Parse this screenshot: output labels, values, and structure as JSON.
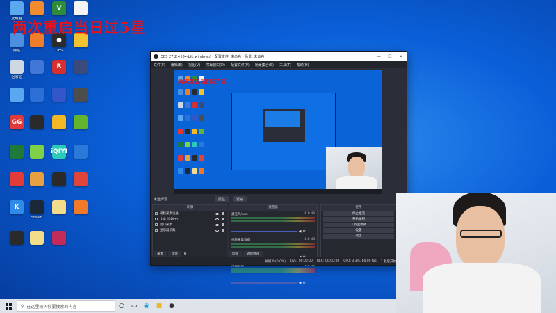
{
  "overlay_title": "两次重启当日过5星",
  "desktop_icons": [
    {
      "label": "此电脑",
      "color": "#5aa8f0",
      "glyph": ""
    },
    {
      "label": "",
      "color": "#f08b30",
      "glyph": ""
    },
    {
      "label": "",
      "color": "#2e8b3a",
      "glyph": "V"
    },
    {
      "label": "",
      "color": "#f4f4f4",
      "glyph": ""
    },
    {
      "label": "网络",
      "color": "#4a8fe0",
      "glyph": ""
    },
    {
      "label": "",
      "color": "#f07d2a",
      "glyph": ""
    },
    {
      "label": "OBS",
      "color": "#2b2b2b",
      "glyph": "●"
    },
    {
      "label": "",
      "color": "#f2c230",
      "glyph": ""
    },
    {
      "label": "回收站",
      "color": "#cfd7e2",
      "glyph": ""
    },
    {
      "label": "",
      "color": "#4178d8",
      "glyph": ""
    },
    {
      "label": "",
      "color": "#d62f2f",
      "glyph": "R"
    },
    {
      "label": "",
      "color": "#3a4a7a",
      "glyph": ""
    },
    {
      "label": "",
      "color": "#5aa8f0",
      "glyph": ""
    },
    {
      "label": "",
      "color": "#2c6fd6",
      "glyph": ""
    },
    {
      "label": "",
      "color": "#3356c8",
      "glyph": ""
    },
    {
      "label": "",
      "color": "#4d4d4d",
      "glyph": ""
    },
    {
      "label": "",
      "color": "#e23a3a",
      "glyph": "GG"
    },
    {
      "label": "",
      "color": "#2a2a2a",
      "glyph": ""
    },
    {
      "label": "",
      "color": "#f2b825",
      "glyph": ""
    },
    {
      "label": "",
      "color": "#63b530",
      "glyph": ""
    },
    {
      "label": "",
      "color": "#1f7a3a",
      "glyph": ""
    },
    {
      "label": "",
      "color": "#7fd247",
      "glyph": ""
    },
    {
      "label": "",
      "color": "#2ccbb8",
      "glyph": "iQIYI"
    },
    {
      "label": "",
      "color": "#2a78d8",
      "glyph": ""
    },
    {
      "label": "",
      "color": "#e33a3a",
      "glyph": ""
    },
    {
      "label": "",
      "color": "#e8a040",
      "glyph": ""
    },
    {
      "label": "",
      "color": "#2a2a2a",
      "glyph": ""
    },
    {
      "label": "",
      "color": "#e0453a",
      "glyph": ""
    },
    {
      "label": "",
      "color": "#2f8be8",
      "glyph": "K"
    },
    {
      "label": "Steam",
      "color": "#1b2838",
      "glyph": ""
    },
    {
      "label": "",
      "color": "#f3dc8a",
      "glyph": ""
    },
    {
      "label": "",
      "color": "#f07a2a",
      "glyph": ""
    },
    {
      "label": "",
      "color": "#2a2a2a",
      "glyph": ""
    },
    {
      "label": "",
      "color": "#f3dc8a",
      "glyph": ""
    },
    {
      "label": "",
      "color": "#c22b5a",
      "glyph": ""
    }
  ],
  "obs": {
    "title": "OBS 27.2.4 (64-bit, windows) - 配置文件: 未命名 - 场景: 未命名",
    "menu": [
      "文件(F)",
      "编辑(E)",
      "视图(V)",
      "停靠窗口(D)",
      "配置文件(P)",
      "场景集合(S)",
      "工具(T)",
      "帮助(H)"
    ],
    "preview_title": "两次重启当日过5星",
    "context_label": "未选择源",
    "context_buttons": [
      "属性",
      "滤镜"
    ],
    "sources_header": "来源",
    "sources": [
      "视频采集设备",
      "文本 (GDI+)",
      "窗口采集",
      "显示器采集"
    ],
    "mixer_header": "混音器",
    "mixer": [
      {
        "name": "麦克风/Aux",
        "db": "0.0 dB"
      },
      {
        "name": "视频采集设备",
        "db": "0.0 dB"
      },
      {
        "name": "桌面音频",
        "db": "0.0 dB"
      }
    ],
    "controls_header": "控件",
    "controls": [
      "停止推流",
      "开始录制",
      "工作室模式",
      "设置",
      "退出"
    ],
    "tabs": [
      "场景",
      "转场特效"
    ],
    "dock_tabs": [
      "来源",
      "场景"
    ],
    "status": {
      "dropped": "掉帧 0 (0.0%)",
      "live": "LIVE: 00:00:00",
      "rec": "REC: 00:00:00",
      "cpu": "CPU: 3.3%, 60.00 fps",
      "cpu2": "1 秒后开始推流"
    }
  },
  "taskbar": {
    "search_placeholder": "在这里输入你要搜索的内容"
  }
}
